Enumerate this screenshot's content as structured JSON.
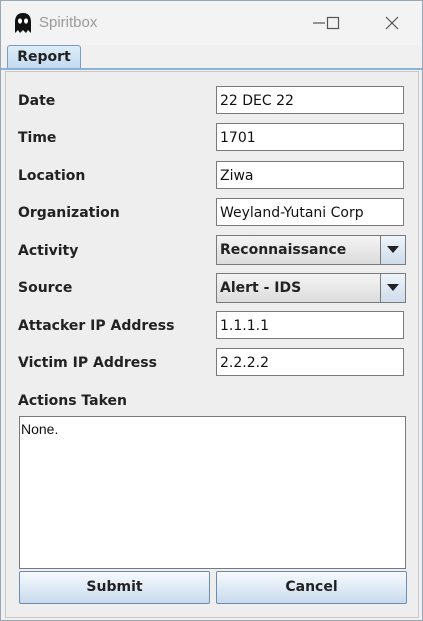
{
  "window": {
    "title": "Spiritbox",
    "app_icon": "ghost-icon",
    "controls": [
      "minimize-icon",
      "maximize-icon",
      "close-icon"
    ]
  },
  "tabs": [
    {
      "label": "Report",
      "selected": true
    }
  ],
  "form": {
    "date": {
      "label": "Date",
      "value": "22 DEC 22"
    },
    "time": {
      "label": "Time",
      "value": "1701"
    },
    "location": {
      "label": "Location",
      "value": "Ziwa"
    },
    "organization": {
      "label": "Organization",
      "value": "Weyland-Yutani Corp"
    },
    "activity": {
      "label": "Activity",
      "selected": "Reconnaissance"
    },
    "source": {
      "label": "Source",
      "selected": "Alert - IDS"
    },
    "attacker_ip": {
      "label": "Attacker IP Address",
      "value": "1.1.1.1"
    },
    "victim_ip": {
      "label": "Victim IP Address",
      "value": "2.2.2.2"
    },
    "actions_taken": {
      "label": "Actions Taken",
      "value": "None."
    }
  },
  "buttons": {
    "submit": "Submit",
    "cancel": "Cancel"
  },
  "colors": {
    "tab_accent": "#8db2d8",
    "button_border": "#6c8db1"
  }
}
